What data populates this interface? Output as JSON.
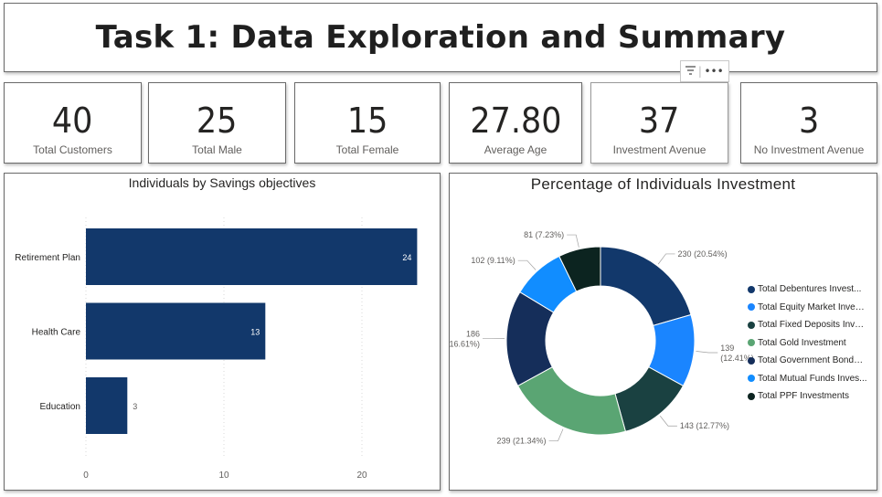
{
  "page": {
    "title": "Task 1: Data Exploration and Summary",
    "visual_header_icons": [
      "filter-icon",
      "more-options-icon"
    ]
  },
  "kpis": [
    {
      "value": "40",
      "label": "Total Customers"
    },
    {
      "value": "25",
      "label": "Total Male"
    },
    {
      "value": "15",
      "label": "Total Female"
    },
    {
      "value": "27.80",
      "label": "Average Age"
    },
    {
      "value": "37",
      "label": "Investment Avenue"
    },
    {
      "value": "3",
      "label": "No Investment Avenue"
    }
  ],
  "chart_data": [
    {
      "type": "bar",
      "orientation": "horizontal",
      "title": "Individuals by Savings objectives",
      "categories": [
        "Retirement Plan",
        "Health Care",
        "Education"
      ],
      "values": [
        24,
        13,
        3
      ],
      "data_labels": [
        "24",
        "13",
        "3"
      ],
      "xlim": [
        0,
        24
      ],
      "x_ticks": [
        0,
        10,
        20
      ],
      "x_tick_labels": [
        "0",
        "10",
        "20"
      ],
      "grid": true,
      "bar_color": "#12386b"
    },
    {
      "type": "pie",
      "style": "donut",
      "title": "Percentage of Individuals Investment",
      "legend_position": "right",
      "series": [
        {
          "name": "Total Debentures Invest...",
          "value": 230,
          "percent": 20.54,
          "label": "230 (20.54%)",
          "color": "#12386b"
        },
        {
          "name": "Total Equity Market Inves...",
          "value": 139,
          "percent": 12.41,
          "label": "139 (12.41%)",
          "color": "#1a85ff"
        },
        {
          "name": "Total Fixed Deposits Inve...",
          "value": 143,
          "percent": 12.77,
          "label": "143 (12.77%)",
          "color": "#1a4141"
        },
        {
          "name": "Total Gold Investment",
          "value": 239,
          "percent": 21.34,
          "label": "239 (21.34%)",
          "color": "#5aa573"
        },
        {
          "name": "Total Government Bonds ...",
          "value": 186,
          "percent": 16.61,
          "label": "186 (16.61%)",
          "color": "#152e5a"
        },
        {
          "name": "Total Mutual Funds Inves...",
          "value": 102,
          "percent": 9.11,
          "label": "102 (9.11%)",
          "color": "#118dff"
        },
        {
          "name": "Total PPF Investments",
          "value": 81,
          "percent": 7.23,
          "label": "81 (7.23%)",
          "color": "#0c2420"
        }
      ]
    }
  ]
}
